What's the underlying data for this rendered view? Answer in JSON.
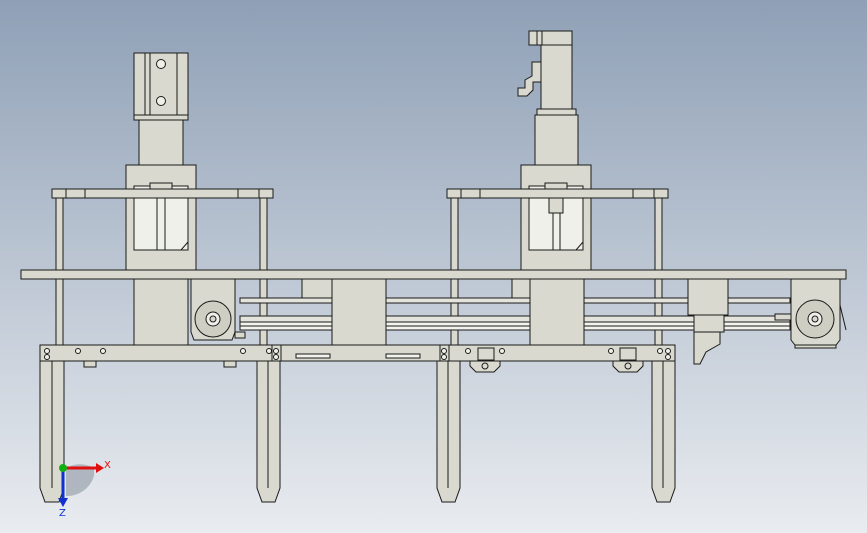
{
  "colors": {
    "bg_top": "#8fa0b6",
    "bg_bottom": "#e9ecf0",
    "part_fill": "#d9d9cf",
    "part_fill_dark": "#c9c9bd",
    "edge": "#1a1a1a",
    "axis_x": "#e01010",
    "axis_y": "#10b010",
    "axis_z": "#1030d0"
  },
  "triad": {
    "x_label": "X",
    "z_label": "Z"
  }
}
